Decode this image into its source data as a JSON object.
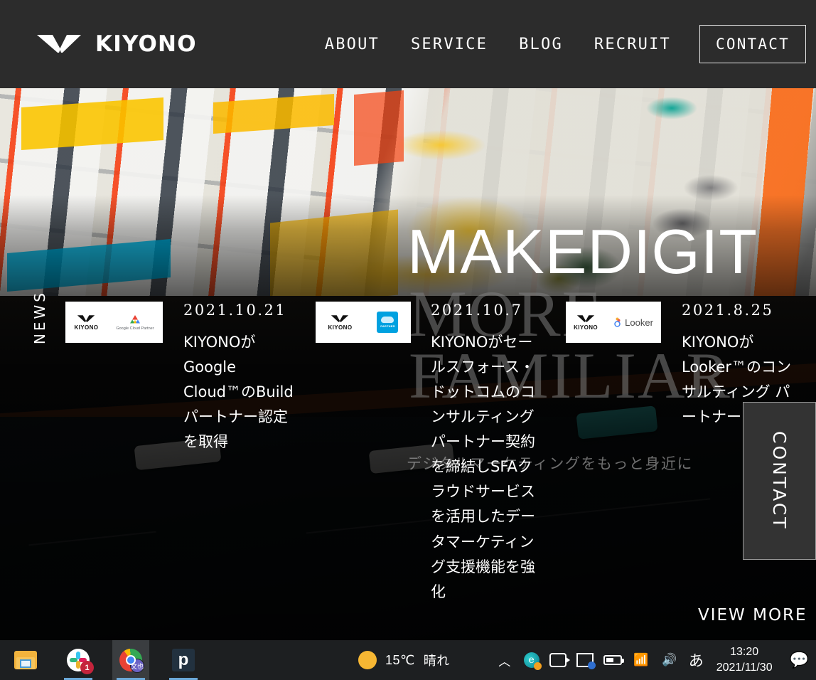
{
  "header": {
    "logo_text": "KIYONO",
    "logo_icon": "kiyono-chevron-mark",
    "nav": [
      {
        "label": "ABOUT"
      },
      {
        "label": "SERVICE"
      },
      {
        "label": "BLOG"
      },
      {
        "label": "RECRUIT"
      }
    ],
    "contact_button": "CONTACT"
  },
  "hero": {
    "headline": "MAKEDIGIT",
    "ghost_line1": "MORE",
    "ghost_line2": "FAMILIAR",
    "tagline": "デジタルマーケティングをもっと身近に"
  },
  "news": {
    "section_label": "NEWS",
    "view_more": "VIEW MORE",
    "items": [
      {
        "date": "2021.10.21",
        "title": "KIYONOがGoogle Cloud™のBuildパートナー認定を取得",
        "thumb_left_text": "KIYONO",
        "thumb_right_text": "Google Cloud Partner"
      },
      {
        "date": "2021.10.7",
        "title": "KIYONOがセールスフォース・ドットコムのコンサルティングパートナー契約を締結しSFAクラウドサービスを活用したデータマーケティング支援機能を強化",
        "thumb_left_text": "KIYONO",
        "thumb_right_text": "PARTNER"
      },
      {
        "date": "2021.8.25",
        "title": "KIYONOがLooker™のコンサルティング パートナー 取得",
        "thumb_left_text": "KIYONO",
        "thumb_right_text": "Looker"
      }
    ]
  },
  "side_tab": {
    "label": "CONTACT"
  },
  "taskbar": {
    "apps": [
      {
        "name": "file-explorer"
      },
      {
        "name": "slack",
        "badge": "1"
      },
      {
        "name": "chrome",
        "avatar": "文也"
      },
      {
        "name": "p-app",
        "glyph": "p"
      }
    ],
    "weather": {
      "temperature": "15℃",
      "condition": "晴れ"
    },
    "tray": {
      "chevron": "︿",
      "ime": "あ",
      "time": "13:20",
      "date": "2021/11/30"
    }
  },
  "colors": {
    "header_bg": "#2c2c2c",
    "taskbar_bg": "#1d1f21",
    "accent_white": "#ffffff",
    "side_tab_bg": "#333333",
    "badge_red": "#c4243c"
  }
}
